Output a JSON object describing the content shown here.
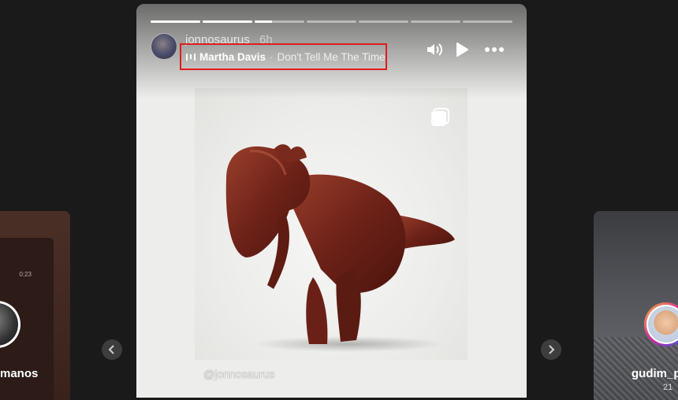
{
  "story": {
    "username": "jonnosaurus",
    "time_ago": "6h",
    "progress_fill": [
      1,
      1,
      0.35,
      0,
      0,
      0,
      0
    ],
    "music": {
      "artist": "Martha Davis",
      "separator": "·",
      "song": "Don't Tell Me The Time"
    },
    "handle": "@jonnosaurus"
  },
  "prev_story": {
    "username": "manos",
    "time": "0:23"
  },
  "next_story": {
    "username": "gudim_p",
    "sub": "21"
  },
  "icons": {
    "sound": "speaker-icon",
    "play": "play-icon",
    "more": "more-icon",
    "multi": "carousel-icon",
    "prev": "chevron-left-icon",
    "next": "chevron-right-icon"
  },
  "colors": {
    "background": "#1a1a1a",
    "highlight_border": "#e01b1b",
    "sculpture": "#7a2a1c"
  }
}
